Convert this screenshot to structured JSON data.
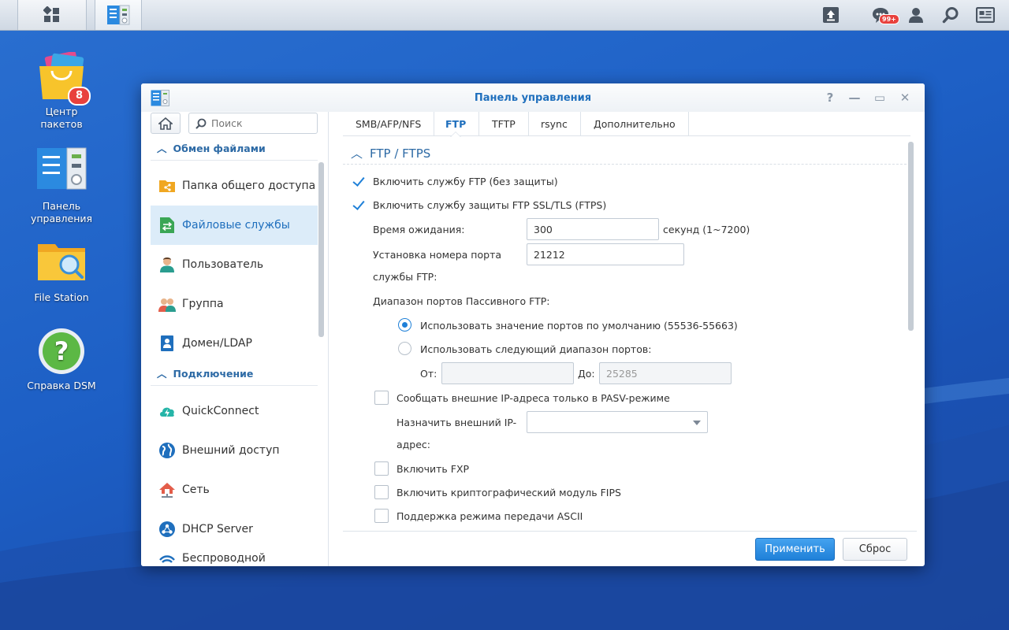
{
  "taskbar": {
    "notification_badge": "99+",
    "right_icons": [
      "upload-icon",
      "notification-icon",
      "user-icon",
      "search-icon",
      "widgets-icon"
    ]
  },
  "desktop": {
    "icons": [
      {
        "label": "Центр пакетов",
        "badge": "8"
      },
      {
        "label": "Панель управления"
      },
      {
        "label": "File Station"
      },
      {
        "label": "Справка DSM"
      }
    ]
  },
  "window": {
    "title": "Панель управления",
    "controls": {
      "help": "?",
      "minimize": "—",
      "maximize": "▭",
      "close": "✕"
    }
  },
  "sidebar": {
    "search_placeholder": "Поиск",
    "sections": [
      {
        "title": "Обмен файлами",
        "items": [
          "Папка общего доступа",
          "Файловые службы",
          "Пользователь",
          "Группа",
          "Домен/LDAP"
        ]
      },
      {
        "title": "Подключение",
        "items": [
          "QuickConnect",
          "Внешний доступ",
          "Сеть",
          "DHCP Server",
          "Беспроводной"
        ]
      }
    ],
    "active_item": "Файловые службы"
  },
  "tabs": [
    "SMB/AFP/NFS",
    "FTP",
    "TFTP",
    "rsync",
    "Дополнительно"
  ],
  "active_tab": "FTP",
  "panel": {
    "title": "FTP / FTPS",
    "enable_ftp": {
      "label": "Включить службу FTP (без защиты)",
      "checked": true
    },
    "enable_ftps": {
      "label": "Включить службу защиты FTP SSL/TLS (FTPS)",
      "checked": true
    },
    "timeout": {
      "label": "Время ожидания:",
      "value": "300",
      "suffix": "секунд (1~7200)"
    },
    "port": {
      "label_line1": "Установка номера порта",
      "label_line2": "службы FTP:",
      "value": "21212"
    },
    "passive_range": {
      "label": "Диапазон портов Пассивного FTP:",
      "default_option": "Использовать значение портов по умолчанию (55536-55663)",
      "custom_option": "Использовать следующий диапазон портов:",
      "from_label": "От:",
      "from_value": "",
      "to_label": "До:",
      "to_value": "25285",
      "selected": "default"
    },
    "pasv_external_ip": {
      "label": "Сообщать внешние IP-адреса только в PASV-режиме",
      "checked": false
    },
    "assign_ip": {
      "label_line1": "Назначить внешний IP-",
      "label_line2": "адрес:",
      "value": ""
    },
    "fxp": {
      "label": "Включить FXP",
      "checked": false
    },
    "fips": {
      "label": "Включить криптографический модуль FIPS",
      "checked": false
    },
    "ascii": {
      "label": "Поддержка режима передачи ASCII",
      "checked": false
    }
  },
  "footer": {
    "apply": "Применить",
    "reset": "Сброс"
  }
}
